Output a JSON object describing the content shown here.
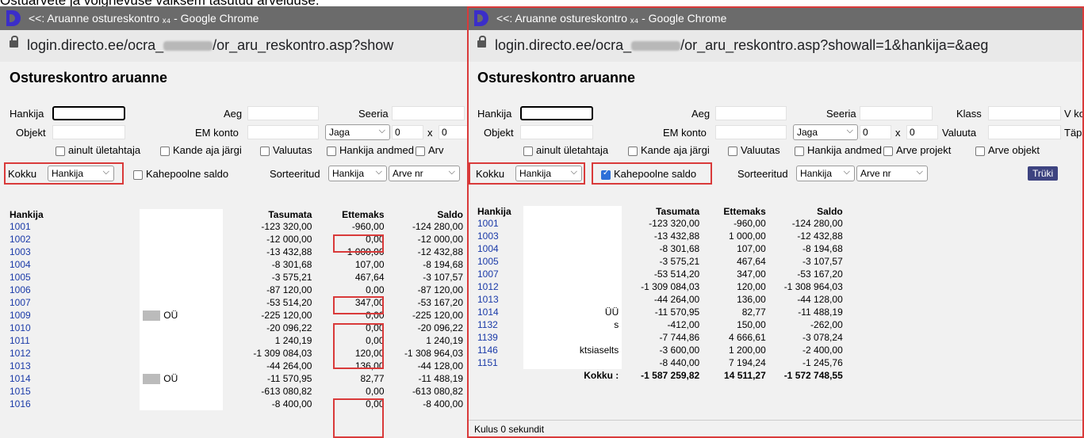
{
  "caption": "Ostuarvete ja võlgnevuse väiksem tasutud arvelduse.",
  "window": {
    "title": "<<: Aruanne ostureskontro ₓ₄ - Google Chrome",
    "url_prefix": "login.directo.ee/ocra_",
    "url_left_suffix": "/or_aru_reskontro.asp?show",
    "url_right_suffix": "/or_aru_reskontro.asp?showall=1&hankija=&aeg"
  },
  "report": {
    "title": "Ostureskontro aruanne",
    "labels": {
      "hankija": "Hankija",
      "aeg": "Aeg",
      "seeria": "Seeria",
      "klass": "Klass",
      "v_ko": "V ko",
      "objekt": "Objekt",
      "em_konto": "EM konto",
      "valuuta": "Valuuta",
      "taps": "Täps",
      "x": "x",
      "kokku": "Kokku",
      "sorteeritud": "Sorteeritud"
    },
    "jaga_value": "Jaga",
    "num_0": "0",
    "kokku_value": "Hankija",
    "sort1_value": "Hankija",
    "sort2_value": "Arve nr",
    "checkboxes": {
      "ainult": "ainult ületahtaja",
      "kande": "Kande aja järgi",
      "valuutas": "Valuutas",
      "hankija_andmed": "Hankija andmed",
      "arve_projekt": "Arve projekt",
      "arve_objekt": "Arve objekt",
      "arv_short": "Arv",
      "kahepoolne": "Kahepoolne saldo"
    },
    "trueki_button": "Trüki",
    "columns": {
      "hankija": "Hankija",
      "tasumata": "Tasumata",
      "ettemaks": "Ettemaks",
      "saldo": "Saldo"
    }
  },
  "left_rows": [
    {
      "id": "1001",
      "name": "",
      "tasumata": "-123 320,00",
      "ettemaks": "-960,00",
      "saldo": "-124 280,00"
    },
    {
      "id": "1002",
      "name": "",
      "tasumata": "-12 000,00",
      "ettemaks": "0,00",
      "saldo": "-12 000,00"
    },
    {
      "id": "1003",
      "name": "",
      "tasumata": "-13 432,88",
      "ettemaks": "1 000,00",
      "saldo": "-12 432,88"
    },
    {
      "id": "1004",
      "name": "",
      "tasumata": "-8 301,68",
      "ettemaks": "107,00",
      "saldo": "-8 194,68"
    },
    {
      "id": "1005",
      "name": "",
      "tasumata": "-3 575,21",
      "ettemaks": "467,64",
      "saldo": "-3 107,57"
    },
    {
      "id": "1006",
      "name": "",
      "tasumata": "-87 120,00",
      "ettemaks": "0,00",
      "saldo": "-87 120,00"
    },
    {
      "id": "1007",
      "name": "",
      "tasumata": "-53 514,20",
      "ettemaks": "347,00",
      "saldo": "-53 167,20"
    },
    {
      "id": "1009",
      "name": "OÜ",
      "tasumata": "-225 120,00",
      "ettemaks": "0,00",
      "saldo": "-225 120,00"
    },
    {
      "id": "1010",
      "name": "",
      "tasumata": "-20 096,22",
      "ettemaks": "0,00",
      "saldo": "-20 096,22"
    },
    {
      "id": "1011",
      "name": "",
      "tasumata": "1 240,19",
      "ettemaks": "0,00",
      "saldo": "1 240,19"
    },
    {
      "id": "1012",
      "name": "",
      "tasumata": "-1 309 084,03",
      "ettemaks": "120,00",
      "saldo": "-1 308 964,03"
    },
    {
      "id": "1013",
      "name": "",
      "tasumata": "-44 264,00",
      "ettemaks": "136,00",
      "saldo": "-44 128,00"
    },
    {
      "id": "1014",
      "name": "OÜ",
      "tasumata": "-11 570,95",
      "ettemaks": "82,77",
      "saldo": "-11 488,19"
    },
    {
      "id": "1015",
      "name": "",
      "tasumata": "-613 080,82",
      "ettemaks": "0,00",
      "saldo": "-613 080,82"
    },
    {
      "id": "1016",
      "name": "",
      "tasumata": "-8 400,00",
      "ettemaks": "0,00",
      "saldo": "-8 400,00"
    }
  ],
  "right_rows": [
    {
      "id": "1001",
      "name": "",
      "tasumata": "-123 320,00",
      "ettemaks": "-960,00",
      "saldo": "-124 280,00"
    },
    {
      "id": "1003",
      "name": "",
      "tasumata": "-13 432,88",
      "ettemaks": "1 000,00",
      "saldo": "-12 432,88"
    },
    {
      "id": "1004",
      "name": "",
      "tasumata": "-8 301,68",
      "ettemaks": "107,00",
      "saldo": "-8 194,68"
    },
    {
      "id": "1005",
      "name": "",
      "tasumata": "-3 575,21",
      "ettemaks": "467,64",
      "saldo": "-3 107,57"
    },
    {
      "id": "1007",
      "name": "",
      "tasumata": "-53 514,20",
      "ettemaks": "347,00",
      "saldo": "-53 167,20"
    },
    {
      "id": "1012",
      "name": "",
      "tasumata": "-1 309 084,03",
      "ettemaks": "120,00",
      "saldo": "-1 308 964,03"
    },
    {
      "id": "1013",
      "name": "",
      "tasumata": "-44 264,00",
      "ettemaks": "136,00",
      "saldo": "-44 128,00"
    },
    {
      "id": "1014",
      "name": "ÜÜ",
      "tasumata": "-11 570,95",
      "ettemaks": "82,77",
      "saldo": "-11 488,19"
    },
    {
      "id": "1132",
      "name": "s",
      "tasumata": "-412,00",
      "ettemaks": "150,00",
      "saldo": "-262,00"
    },
    {
      "id": "1139",
      "name": "",
      "tasumata": "-7 744,86",
      "ettemaks": "4 666,61",
      "saldo": "-3 078,24"
    },
    {
      "id": "1146",
      "name": "ktsiaselts",
      "tasumata": "-3 600,00",
      "ettemaks": "1 200,00",
      "saldo": "-2 400,00"
    },
    {
      "id": "1151",
      "name": "",
      "tasumata": "-8 440,00",
      "ettemaks": "7 194,24",
      "saldo": "-1 245,76"
    }
  ],
  "right_total": {
    "label": "Kokku :",
    "tasumata": "-1 587 259,82",
    "ettemaks": "14 511,27",
    "saldo": "-1 572 748,55"
  },
  "footer": "Kulus 0 sekundit",
  "colors": {
    "highlight_red": "#d93a3a",
    "link_blue": "#1a3aa8",
    "button": "#3d4380",
    "checkbox_checked": "#2d6fd8"
  }
}
